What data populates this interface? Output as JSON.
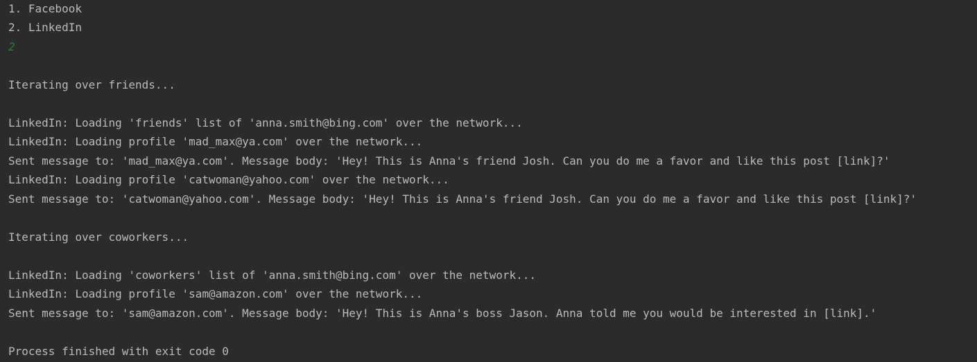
{
  "console": {
    "lines": [
      "1. Facebook",
      "2. LinkedIn",
      "2",
      "Iterating over friends...",
      "LinkedIn: Loading 'friends' list of 'anna.smith@bing.com' over the network...",
      "LinkedIn: Loading profile 'mad_max@ya.com' over the network...",
      "Sent message to: 'mad_max@ya.com'. Message body: 'Hey! This is Anna's friend Josh. Can you do me a favor and like this post [link]?'",
      "LinkedIn: Loading profile 'catwoman@yahoo.com' over the network...",
      "Sent message to: 'catwoman@yahoo.com'. Message body: 'Hey! This is Anna's friend Josh. Can you do me a favor and like this post [link]?'",
      "Iterating over coworkers...",
      "LinkedIn: Loading 'coworkers' list of 'anna.smith@bing.com' over the network...",
      "LinkedIn: Loading profile 'sam@amazon.com' over the network...",
      "Sent message to: 'sam@amazon.com'. Message body: 'Hey! This is Anna's boss Jason. Anna told me you would be interested in [link].'",
      "Process finished with exit code 0"
    ]
  },
  "colors": {
    "background": "#2b2b2b",
    "text": "#bbbbbb",
    "user_input": "#2f7d32"
  }
}
